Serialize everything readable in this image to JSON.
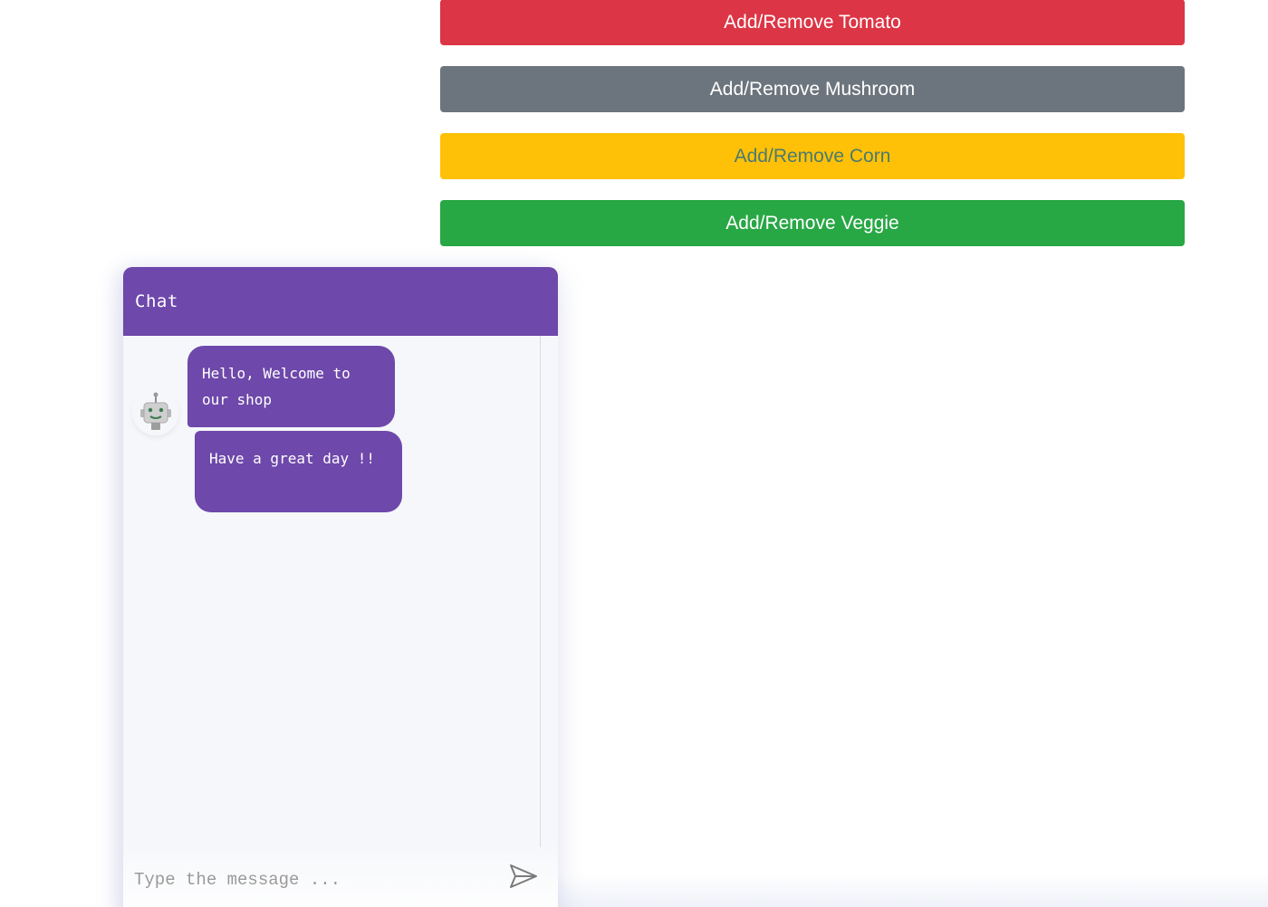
{
  "buttons": {
    "tomato": "Add/Remove Tomato",
    "mushroom": "Add/Remove Mushroom",
    "corn": "Add/Remove Corn",
    "veggie": "Add/Remove Veggie"
  },
  "colors": {
    "tomato": "#dc3545",
    "mushroom": "#6c757d",
    "corn": "#ffc107",
    "veggie": "#28a745",
    "chat_accent": "#6e48aa"
  },
  "chat": {
    "title": "Chat",
    "avatar_icon": "robot-icon",
    "messages": [
      {
        "sender": "bot",
        "text": "Hello, Welcome to our shop"
      },
      {
        "sender": "bot",
        "text": "Have a great day !!"
      }
    ],
    "input": {
      "value": "",
      "placeholder": "Type the message ..."
    },
    "send_icon": "send-icon"
  }
}
